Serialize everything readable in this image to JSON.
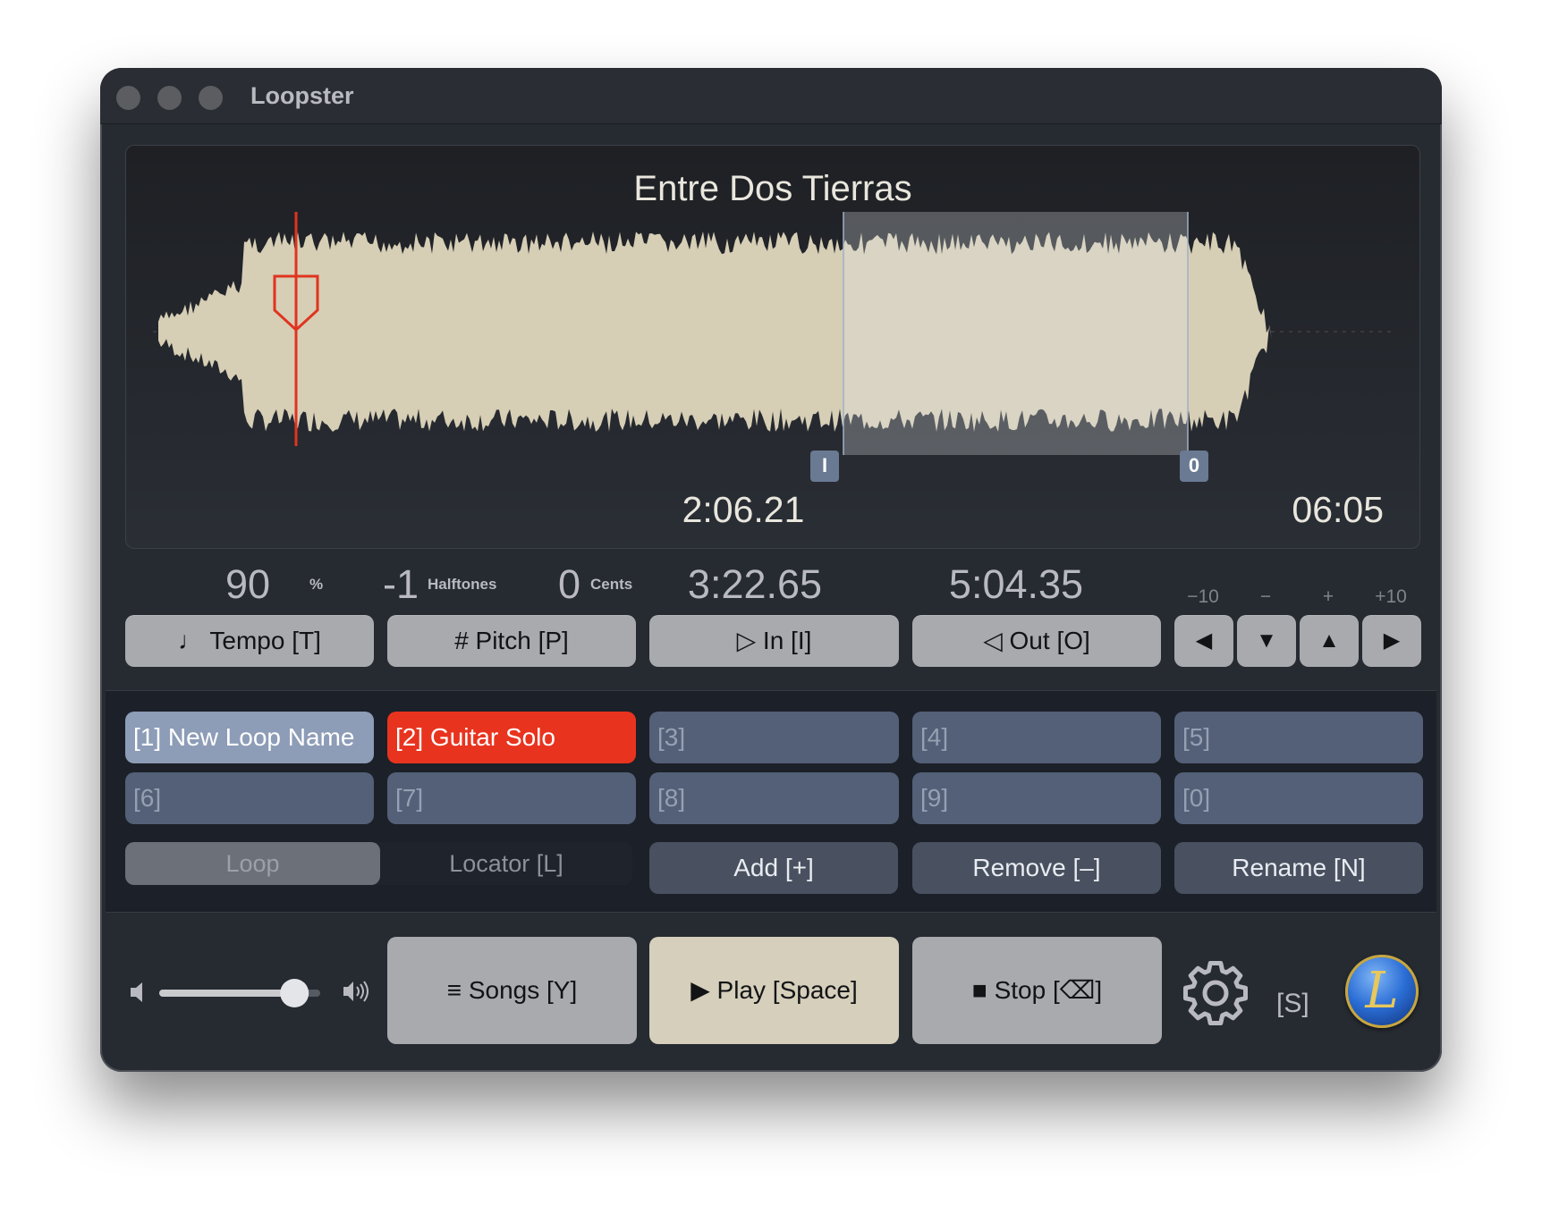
{
  "window": {
    "title": "Loopster"
  },
  "waveform": {
    "song_title": "Entre Dos Tierras",
    "current_time": "2:06.21",
    "total_time": "06:05",
    "in_marker": "I",
    "out_marker": "0",
    "colors": {
      "wave": "#d6ceb5",
      "selection": "#c8cabf",
      "playhead": "#e0341f"
    }
  },
  "controls": {
    "tempo_value": "90",
    "tempo_unit": "%",
    "pitch_value": "-1",
    "pitch_unit": "Halftones",
    "cents_value": "0",
    "cents_unit": "Cents",
    "in_time": "3:22.65",
    "out_time": "5:04.35",
    "tempo_button": "♩ Tempo [T]",
    "pitch_button": "# Pitch [P]",
    "in_button": "▷ In [I]",
    "out_button": "◁ Out [O]",
    "nudge_labels": [
      "−10",
      "−",
      "+",
      "+10"
    ],
    "nudge_buttons": [
      "◀",
      "▼",
      "▲",
      "▶"
    ]
  },
  "loops": {
    "slots": [
      "[1] New Loop Name",
      "[2] Guitar Solo",
      "[3]",
      "[4]",
      "[5]",
      "[6]",
      "[7]",
      "[8]",
      "[9]",
      "[0]"
    ],
    "mode_loop": "Loop",
    "mode_locator": "Locator [L]",
    "add": "Add [+]",
    "remove": "Remove [–]",
    "rename": "Rename [N]"
  },
  "transport": {
    "volume_level": 0.84,
    "songs": "≡ Songs [Y]",
    "play": "▶ Play [Space]",
    "stop": "■ Stop [⌫]",
    "settings_shortcut": "[S]",
    "logo_letter": "L",
    "colors": {
      "play_bg": "#d5cfbb",
      "button_bg": "#a8aaae",
      "active_slot": "#e8341f"
    }
  }
}
